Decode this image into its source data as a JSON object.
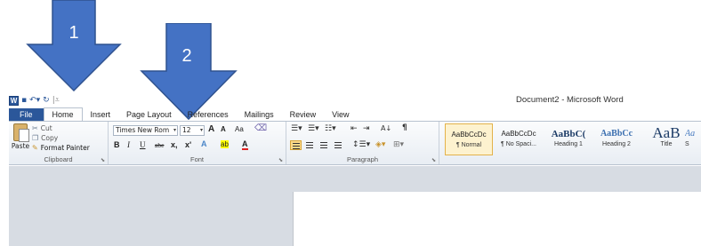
{
  "annotations": {
    "arrow1_label": "1",
    "arrow2_label": "2",
    "arrow_color": "#4472c4"
  },
  "window": {
    "title": "Document2 - Microsoft Word",
    "app_icon": "W",
    "qat_items": [
      "save-icon",
      "undo-icon",
      "redo-icon",
      "customize-icon"
    ]
  },
  "tabs": [
    "File",
    "Home",
    "Insert",
    "Page Layout",
    "References",
    "Mailings",
    "Review",
    "View"
  ],
  "clipboard": {
    "paste": "Paste",
    "cut": "Cut",
    "copy": "Copy",
    "format_painter": "Format Painter",
    "label": "Clipboard"
  },
  "font": {
    "name": "Times New Rom",
    "size": "12",
    "grow": "A",
    "shrink": "A",
    "case": "Aa",
    "bold": "B",
    "italic": "I",
    "underline": "U",
    "strike": "abe",
    "subscript": "x,",
    "superscript": "x'",
    "text_effects": "A",
    "highlight": "ab",
    "font_color": "A",
    "label": "Font"
  },
  "paragraph": {
    "label": "Paragraph",
    "sort": "A↓",
    "show_marks": "¶"
  },
  "styles": [
    {
      "sample": "AaBbCcDc",
      "name": "¶ Normal",
      "selected": true
    },
    {
      "sample": "AaBbCcDc",
      "name": "¶ No Spaci...",
      "selected": false
    },
    {
      "sample": "AaBbC(",
      "name": "Heading 1",
      "selected": false
    },
    {
      "sample": "AaBbCc",
      "name": "Heading 2",
      "selected": false
    },
    {
      "sample": "AaB",
      "name": "Title",
      "selected": false
    },
    {
      "sample": "Aa",
      "name": "S",
      "selected": false
    }
  ]
}
